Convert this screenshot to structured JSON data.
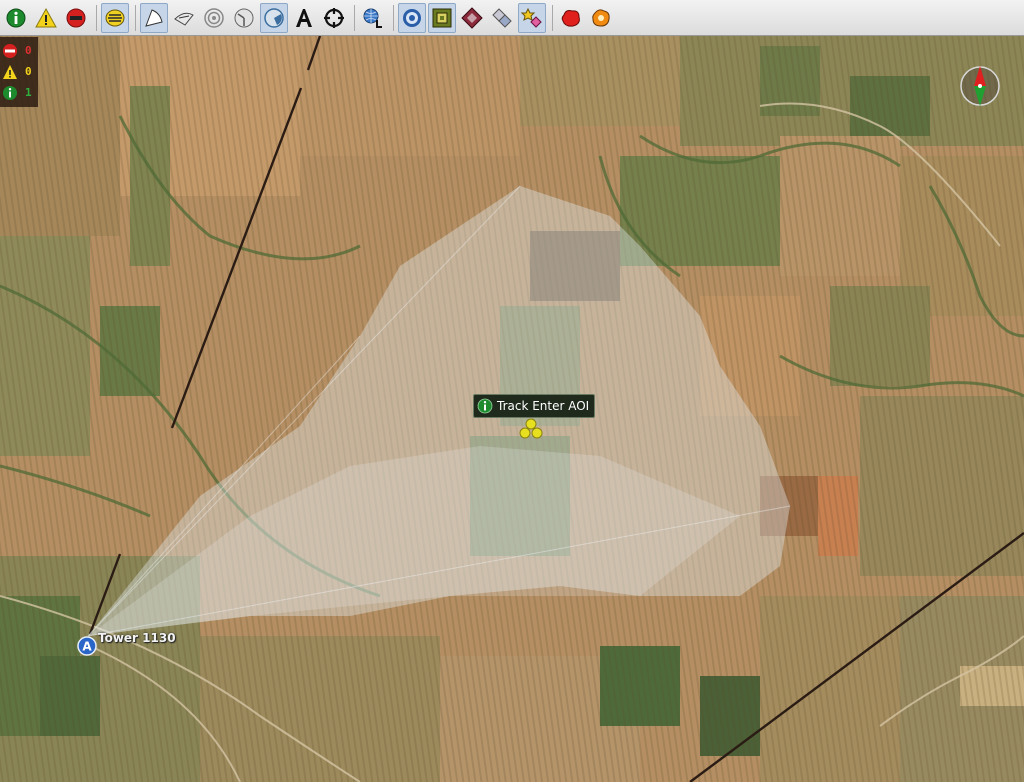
{
  "toolbar": {
    "buttons": [
      {
        "icon": "info-icon"
      },
      {
        "icon": "warning-icon"
      },
      {
        "icon": "stop-icon"
      },
      {
        "icon": "layers-icon"
      },
      {
        "icon": "sector-white-icon"
      },
      {
        "icon": "eye-sector-icon"
      },
      {
        "icon": "target-rings-icon"
      },
      {
        "icon": "clock-sector-icon"
      },
      {
        "icon": "dome-icon"
      },
      {
        "icon": "text-a-icon"
      },
      {
        "icon": "crosshair-icon"
      },
      {
        "icon": "globe-l-icon"
      },
      {
        "icon": "bullseye-icon"
      },
      {
        "icon": "square-target-icon"
      },
      {
        "icon": "diamond-icon"
      },
      {
        "icon": "diamonds-pair-icon"
      },
      {
        "icon": "star-diamond-icon"
      },
      {
        "icon": "red-blob-icon"
      },
      {
        "icon": "orange-blob-icon"
      }
    ]
  },
  "alert_counters": {
    "stop_count": "0",
    "warning_count": "0",
    "info_count": "1"
  },
  "map": {
    "track_label": "Track Enter AOI",
    "tower_label": "Tower 1130",
    "tower_icon_letter": "A"
  },
  "colors": {
    "info_green": "#1e8a2e",
    "warning_yellow": "#f2d21a",
    "stop_red": "#d52020",
    "track_yellow": "#e6e020",
    "coverage_fill": "#e6eef4"
  }
}
